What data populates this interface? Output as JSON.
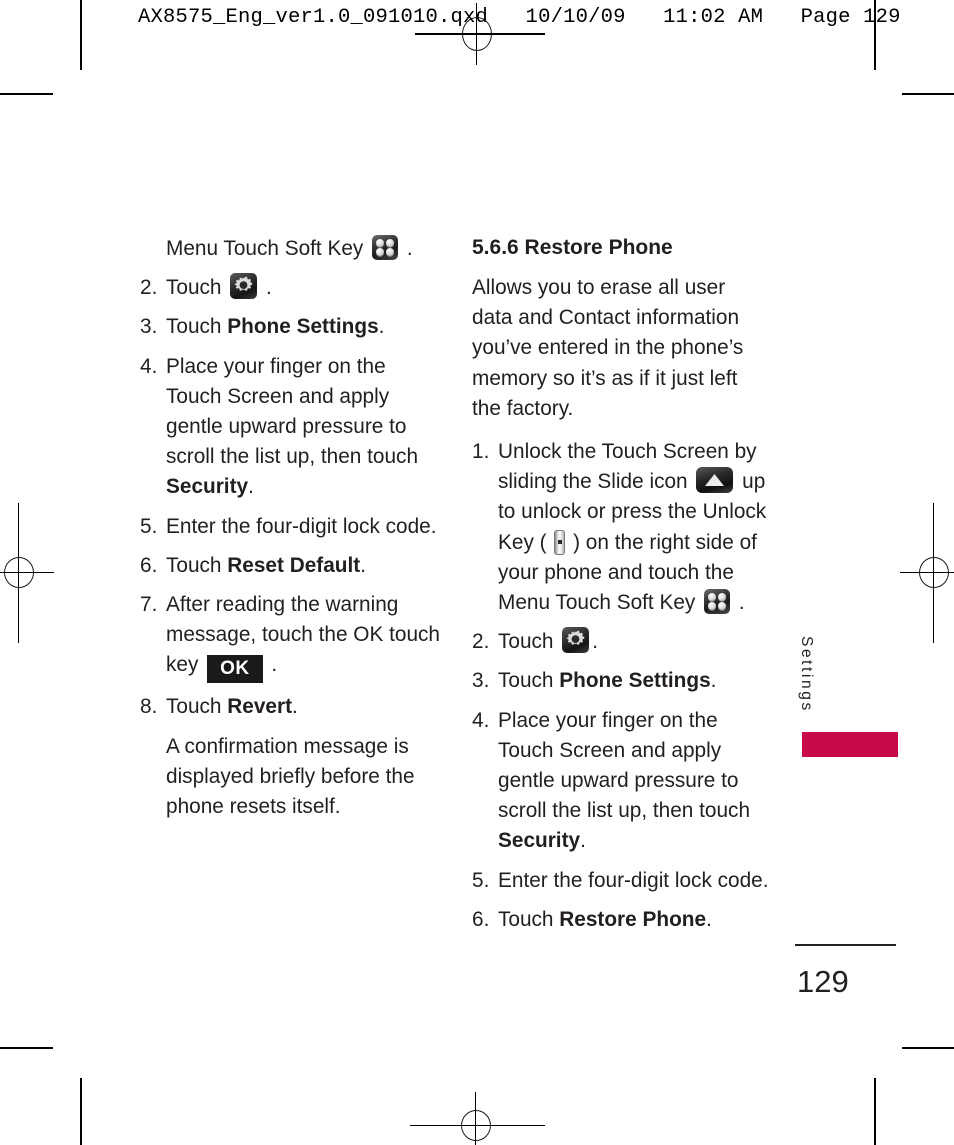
{
  "slug": {
    "text": "AX8575_Eng_ver1.0_091010.qxd   10/10/09   11:02 AM   Page 129"
  },
  "left_column": {
    "items": [
      {
        "kind": "continuation",
        "text_before": "Menu Touch Soft Key ",
        "icon": "menu-soft-key-icon",
        "text_after": " ."
      },
      {
        "kind": "step",
        "num": "2.",
        "text_before": "Touch  ",
        "icon": "gear-settings-icon",
        "text_after": " ."
      },
      {
        "kind": "step",
        "num": "3.",
        "text_before": "Touch ",
        "bold": "Phone Settings",
        "text_after": "."
      },
      {
        "kind": "step",
        "num": "4.",
        "text_before": "Place your finger on the Touch Screen and apply gentle upward pressure to scroll the list up, then touch ",
        "bold": "Security",
        "text_after": "."
      },
      {
        "kind": "step",
        "num": "5.",
        "text_before": "Enter the four-digit lock code."
      },
      {
        "kind": "step",
        "num": "6.",
        "text_before": "Touch ",
        "bold": "Reset Default",
        "text_after": "."
      },
      {
        "kind": "step",
        "num": "7.",
        "text_before": "After reading the warning message, touch the OK touch key ",
        "badge": "OK",
        "text_after": " ."
      },
      {
        "kind": "step",
        "num": "8.",
        "text_before": "Touch ",
        "bold": "Revert",
        "text_after": "."
      },
      {
        "kind": "plain",
        "text_before": "A confirmation message is displayed briefly before the phone resets itself."
      }
    ]
  },
  "right_column": {
    "heading": "5.6.6 Restore Phone",
    "intro": "Allows you to erase all user data and Contact information you’ve entered in the phone’s memory so it’s as if it just left the factory.",
    "items": [
      {
        "kind": "step",
        "num": "1.",
        "seg1": "Unlock the Touch Screen by sliding the Slide icon ",
        "icon1": "slide-up-icon",
        "seg2": " up to unlock or press the Unlock Key ( ",
        "icon2": "unlock-side-key-icon",
        "seg3": " ) on the right side of your phone and touch the Menu Touch Soft Key ",
        "icon3": "menu-soft-key-icon",
        "seg4": " ."
      },
      {
        "kind": "step",
        "num": "2.",
        "text_before": "Touch  ",
        "icon": "gear-settings-icon",
        "text_after": "."
      },
      {
        "kind": "step",
        "num": "3.",
        "text_before": "Touch ",
        "bold": "Phone Settings",
        "text_after": "."
      },
      {
        "kind": "step",
        "num": "4.",
        "text_before": "Place your finger on the Touch Screen and apply gentle upward pressure to scroll the list up, then touch ",
        "bold": "Security",
        "text_after": "."
      },
      {
        "kind": "step",
        "num": "5.",
        "text_before": "Enter the four-digit lock code."
      },
      {
        "kind": "step",
        "num": "6.",
        "text_before": "Touch ",
        "bold": "Restore Phone",
        "text_after": "."
      }
    ]
  },
  "side_tab": {
    "label": "Settings",
    "color": "#c5094b"
  },
  "footer": {
    "page_number": "129"
  }
}
